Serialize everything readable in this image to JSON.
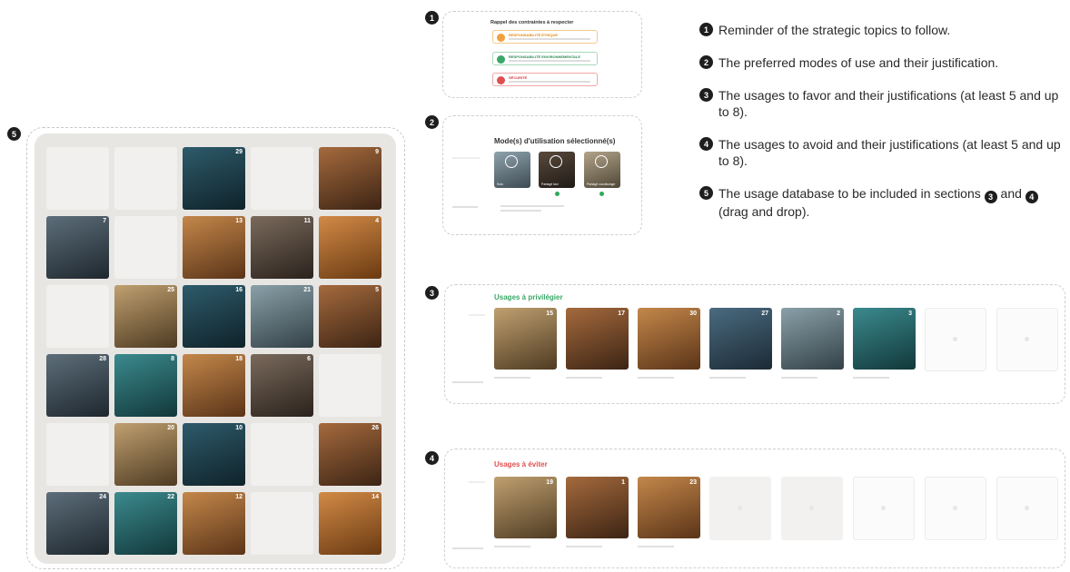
{
  "markers": {
    "m1": "1",
    "m2": "2",
    "m3": "3",
    "m4": "4",
    "m5": "5"
  },
  "legend": {
    "item1": "Reminder of the strategic topics to follow.",
    "item2": "The preferred modes of use and their justification.",
    "item3": "The usages to favor and their justifications (at least 5 and up to 8).",
    "item4": "The usages to avoid and their justifications (at least 5 and up to 8).",
    "item5_pre": "The usage database to be included in sections",
    "item5_and": "and",
    "item5_post": "(drag and drop).",
    "ref3": "3",
    "ref4": "4"
  },
  "constraints": {
    "title": "Rappel des contraintes à respecter",
    "items": [
      {
        "label": "RESPONSABILITÉ ÉTHIQUE",
        "color": "#f0a040"
      },
      {
        "label": "RESPONSABILITÉ ENVIRONNEMENTALE",
        "color": "#3aa867"
      },
      {
        "label": "SÉCURITÉ",
        "color": "#e05050"
      }
    ]
  },
  "modes": {
    "title": "Mode(s) d'utilisation sélectionné(s)",
    "cards": [
      {
        "label": "Solo"
      },
      {
        "label": "Partagé taxi"
      },
      {
        "label": "Partagé covoiturage"
      }
    ]
  },
  "favor": {
    "title": "Usages à privilégier",
    "title_color": "#3aa867",
    "cards": [
      {
        "num": "15"
      },
      {
        "num": "17"
      },
      {
        "num": "30"
      },
      {
        "num": "27"
      },
      {
        "num": "2"
      },
      {
        "num": "3"
      }
    ]
  },
  "avoid": {
    "title": "Usages à éviter",
    "title_color": "#e05050",
    "cards": [
      {
        "num": "19"
      },
      {
        "num": "1"
      },
      {
        "num": "23"
      }
    ]
  },
  "database": {
    "cells": [
      {
        "num": ""
      },
      {
        "num": ""
      },
      {
        "num": "29"
      },
      {
        "num": ""
      },
      {
        "num": "9"
      },
      {
        "num": "7"
      },
      {
        "num": ""
      },
      {
        "num": "13"
      },
      {
        "num": "11"
      },
      {
        "num": "4"
      },
      {
        "num": ""
      },
      {
        "num": "25"
      },
      {
        "num": "16"
      },
      {
        "num": "21"
      },
      {
        "num": "5"
      },
      {
        "num": "28"
      },
      {
        "num": "8"
      },
      {
        "num": "18"
      },
      {
        "num": "6"
      },
      {
        "num": ""
      },
      {
        "num": ""
      },
      {
        "num": "20"
      },
      {
        "num": "10"
      },
      {
        "num": ""
      },
      {
        "num": "26"
      },
      {
        "num": "24"
      },
      {
        "num": "22"
      },
      {
        "num": "12"
      },
      {
        "num": ""
      },
      {
        "num": "14"
      }
    ]
  }
}
